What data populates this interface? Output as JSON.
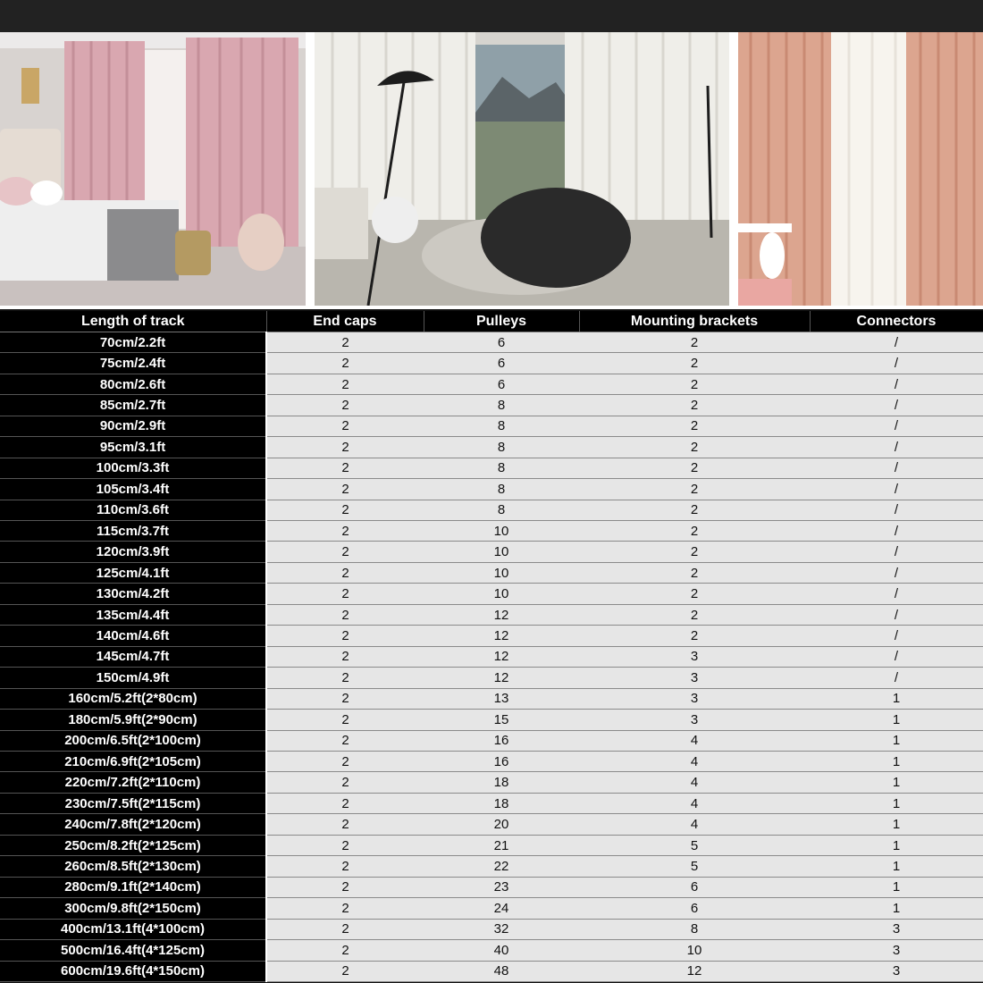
{
  "table": {
    "headers": [
      "Length of track",
      "End caps",
      "Pulleys",
      "Mounting brackets",
      "Connectors"
    ],
    "rows": [
      [
        "70cm/2.2ft",
        "2",
        "6",
        "2",
        "/"
      ],
      [
        "75cm/2.4ft",
        "2",
        "6",
        "2",
        "/"
      ],
      [
        "80cm/2.6ft",
        "2",
        "6",
        "2",
        "/"
      ],
      [
        "85cm/2.7ft",
        "2",
        "8",
        "2",
        "/"
      ],
      [
        "90cm/2.9ft",
        "2",
        "8",
        "2",
        "/"
      ],
      [
        "95cm/3.1ft",
        "2",
        "8",
        "2",
        "/"
      ],
      [
        "100cm/3.3ft",
        "2",
        "8",
        "2",
        "/"
      ],
      [
        "105cm/3.4ft",
        "2",
        "8",
        "2",
        "/"
      ],
      [
        "110cm/3.6ft",
        "2",
        "8",
        "2",
        "/"
      ],
      [
        "115cm/3.7ft",
        "2",
        "10",
        "2",
        "/"
      ],
      [
        "120cm/3.9ft",
        "2",
        "10",
        "2",
        "/"
      ],
      [
        "125cm/4.1ft",
        "2",
        "10",
        "2",
        "/"
      ],
      [
        "130cm/4.2ft",
        "2",
        "10",
        "2",
        "/"
      ],
      [
        "135cm/4.4ft",
        "2",
        "12",
        "2",
        "/"
      ],
      [
        "140cm/4.6ft",
        "2",
        "12",
        "2",
        "/"
      ],
      [
        "145cm/4.7ft",
        "2",
        "12",
        "3",
        "/"
      ],
      [
        "150cm/4.9ft",
        "2",
        "12",
        "3",
        "/"
      ],
      [
        "160cm/5.2ft(2*80cm)",
        "2",
        "13",
        "3",
        "1"
      ],
      [
        "180cm/5.9ft(2*90cm)",
        "2",
        "15",
        "3",
        "1"
      ],
      [
        "200cm/6.5ft(2*100cm)",
        "2",
        "16",
        "4",
        "1"
      ],
      [
        "210cm/6.9ft(2*105cm)",
        "2",
        "16",
        "4",
        "1"
      ],
      [
        "220cm/7.2ft(2*110cm)",
        "2",
        "18",
        "4",
        "1"
      ],
      [
        "230cm/7.5ft(2*115cm)",
        "2",
        "18",
        "4",
        "1"
      ],
      [
        "240cm/7.8ft(2*120cm)",
        "2",
        "20",
        "4",
        "1"
      ],
      [
        "250cm/8.2ft(2*125cm)",
        "2",
        "21",
        "5",
        "1"
      ],
      [
        "260cm/8.5ft(2*130cm)",
        "2",
        "22",
        "5",
        "1"
      ],
      [
        "280cm/9.1ft(2*140cm)",
        "2",
        "23",
        "6",
        "1"
      ],
      [
        "300cm/9.8ft(2*150cm)",
        "2",
        "24",
        "6",
        "1"
      ],
      [
        "400cm/13.1ft(4*100cm)",
        "2",
        "32",
        "8",
        "3"
      ],
      [
        "500cm/16.4ft(4*125cm)",
        "2",
        "40",
        "10",
        "3"
      ],
      [
        "600cm/19.6ft(4*150cm)",
        "2",
        "48",
        "12",
        "3"
      ]
    ]
  },
  "colors": {
    "header_bg": "#000000",
    "length_col_bg": "#000000",
    "value_cell_bg": "#e6e6e6",
    "curtain_pink": "#d9a7b0",
    "curtain_sheer": "#efeee9",
    "curtain_coral": "#dca58f"
  }
}
